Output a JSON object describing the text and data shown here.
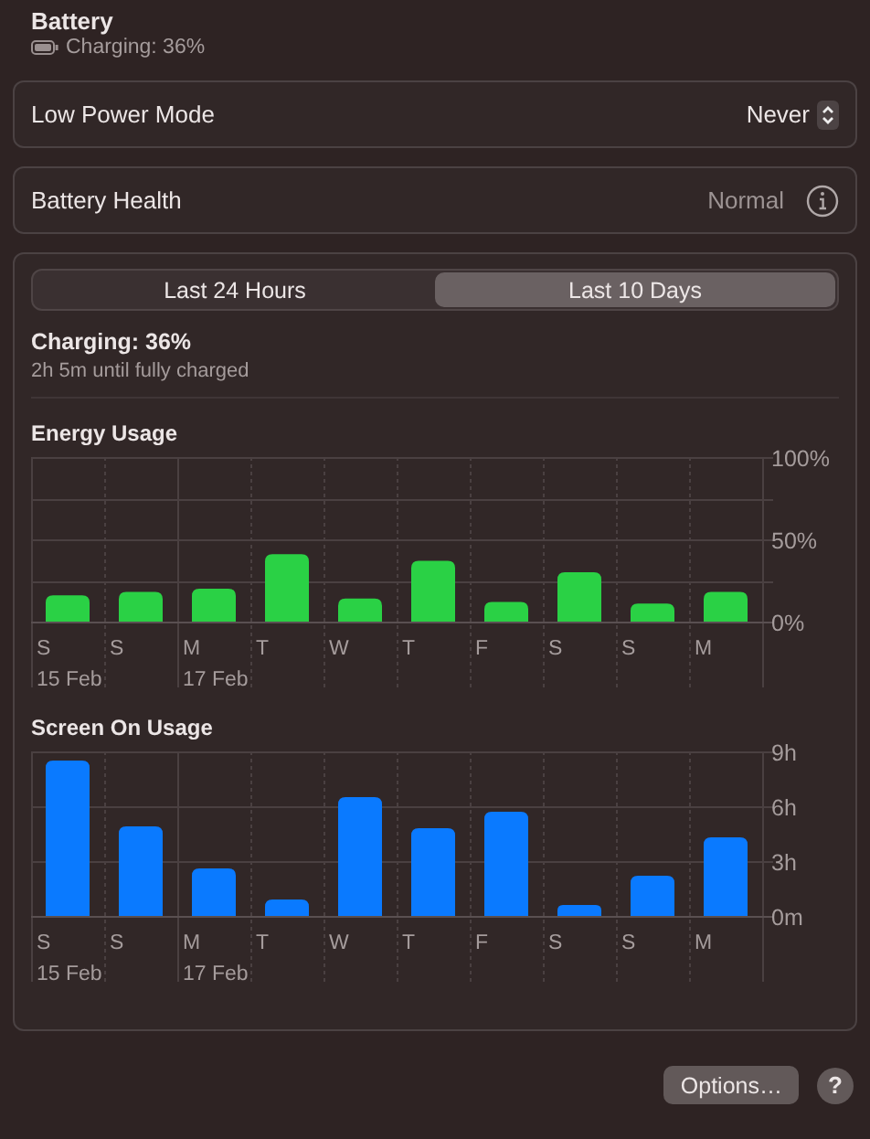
{
  "header": {
    "title": "Battery",
    "status": "Charging: 36%"
  },
  "settings": [
    {
      "kind": "popup",
      "label": "Low Power Mode",
      "value": "Never"
    },
    {
      "kind": "info",
      "label": "Battery Health",
      "value": "Normal"
    }
  ],
  "range_tabs": [
    {
      "label": "Last 24 Hours",
      "selected": false
    },
    {
      "label": "Last 10 Days",
      "selected": true
    }
  ],
  "charge": {
    "title": "Charging: 36%",
    "detail": "2h 5m until fully charged"
  },
  "charts": [
    {
      "chart_data": {
        "type": "bar",
        "title": "Energy Usage",
        "categories": [
          "S",
          "S",
          "M",
          "T",
          "W",
          "T",
          "F",
          "S",
          "S",
          "M"
        ],
        "series": [
          {
            "color": "#2ad145",
            "values": [
              16,
              18,
              20,
              41,
              14,
              37,
              12,
              30,
              11,
              18
            ]
          }
        ],
        "ylim": [
          0,
          100
        ],
        "yticks": [
          {
            "value": 0,
            "label": "0%"
          },
          {
            "value": 50,
            "label": "50%"
          },
          {
            "value": 100,
            "label": "100%"
          }
        ]
      },
      "date_row": [
        "15 Feb",
        "17 Feb"
      ]
    },
    {
      "chart_data": {
        "type": "bar",
        "title": "Screen On Usage",
        "categories": [
          "S",
          "S",
          "M",
          "T",
          "W",
          "T",
          "F",
          "S",
          "S",
          "M"
        ],
        "series": [
          {
            "color": "#0a7aff",
            "values": [
              8.5,
              4.9,
              2.6,
              0.9,
              6.5,
              4.8,
              5.7,
              0.6,
              2.2,
              4.3
            ]
          }
        ],
        "ylim": [
          0,
          9
        ],
        "yticks": [
          {
            "value": 0,
            "label": "0m"
          },
          {
            "value": 3,
            "label": "3h"
          },
          {
            "value": 6,
            "label": "6h"
          },
          {
            "value": 9,
            "label": "9h"
          }
        ]
      },
      "date_row": [
        "15 Feb",
        "17 Feb"
      ]
    }
  ],
  "footer": {
    "options_button": "Options…",
    "help_button": "?"
  }
}
